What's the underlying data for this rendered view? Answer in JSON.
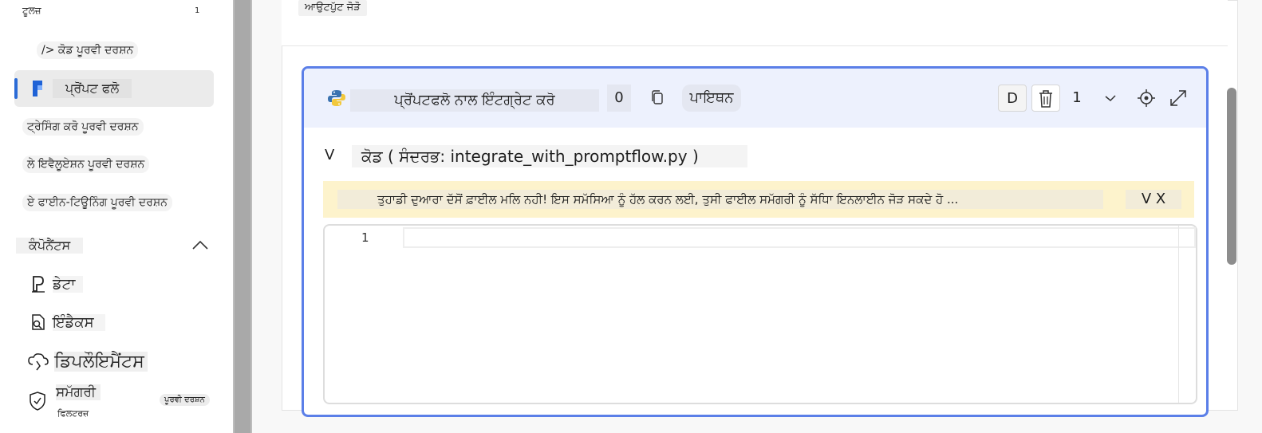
{
  "sidebar": {
    "tools_header": "ਟੂਲਜ਼",
    "tools_count": "1",
    "items": [
      {
        "label": "/> ਕੋਡ ਪੂਰਵੀ ਦਰਸ਼ਨ"
      },
      {
        "label": "ਪ੍ਰੋਂਪਟ ਫਲੋ"
      },
      {
        "label": "ਟ੍ਰੇਸਿੰਗ ਕਰੋ ਪੂਰਵੀ ਦਰਸ਼ਨ"
      },
      {
        "label": "ਲੇ ਇਵੈਲੂਏਸ਼ਨ ਪੂਰਵੀ ਦਰਸ਼ਨ"
      },
      {
        "label": "ਏ ਫਾਈਨ-ਟਿਊਨਿੰਗ ਪੂਰਵੀ ਦਰਸ਼ਨ"
      }
    ],
    "components_header": "ਕੰਪੋਨੈਂਟਸ",
    "components": [
      {
        "label": "ਡੇਟਾ"
      },
      {
        "label": "ਇੰਡੈਕਸ"
      },
      {
        "label": "ਡਿਪਲੌਇਮੈਂਟਸ"
      },
      {
        "label": "ਸਮੱਗਰੀ",
        "sublabel": "ਫਿਲਟਰਜ਼",
        "badge": "ਪੂਰਵੀ ਦਰਸ਼ਨ"
      }
    ]
  },
  "main": {
    "add_output": "ਆਉਟਪੁੱਟ ਜੋੜੋ",
    "node": {
      "title": "ਪ੍ਰੋਂਪਟਫਲੋ ਨਾਲ ਇੰਟਗ੍ਰੇਟ ਕਰੋ",
      "count": "0",
      "language": "ਪਾਇਥਨ",
      "d_label": "D",
      "number": "1",
      "code_label": "ਕੋਡ ( ਸੰਦਰਭ: integrate_with_promptflow.py )",
      "chevron": "V",
      "warning": "ਤੁਹਾਡੀ ਦੁਆਰਾ ਦੱਸੋਂ ਫ਼ਾਈਲ ਮਲਿ ਨਹੀ! ਇਸ ਸਮੱਸਿਆ ਨੂੰ ਹੱਲ ਕਰਨ ਲਈ, ਤੁਸੀ ਫਾਈਲ ਸਮੱਗਰੀ ਨੂੰ ਸੱਧਿਾ ਇਨਲਾਈਨ ਜੋੜ ਸਕਦੇ ਹੋ ...",
      "warning_actions": "V X",
      "line_number": "1"
    }
  },
  "colors": {
    "accent": "#5b7fe8",
    "active_bar": "#2b6bd6",
    "header_bg": "#edf1fd",
    "warning_bg": "#fdf3cc"
  }
}
